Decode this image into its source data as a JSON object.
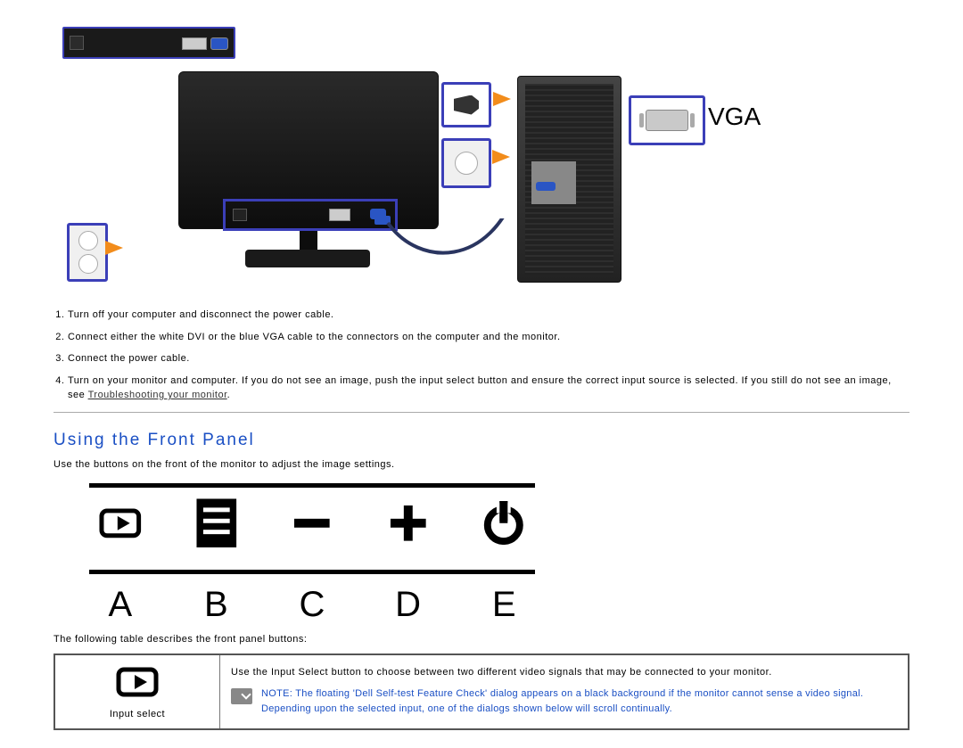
{
  "diagram": {
    "vga_label": "VGA"
  },
  "steps": {
    "s1": "Turn off your computer and disconnect the power cable.",
    "s2": "Connect either the white DVI or the blue VGA cable to the connectors on the computer and the monitor.",
    "s3": "Connect the power cable.",
    "s4a": "Turn on your monitor and computer. If you do not see an image, push the input select button and ensure the correct input source is selected. If you still do not see an image, see ",
    "s4_link": "Troubleshooting your monitor",
    "s4b": "."
  },
  "section_title": "Using the Front Panel",
  "section_intro": "Use the buttons on the front of the monitor to adjust the image settings.",
  "panel_labels": {
    "a": "A",
    "b": "B",
    "c": "C",
    "d": "D",
    "e": "E"
  },
  "table_intro": "The following table describes the front panel buttons:",
  "table": {
    "input_select_label": "Input select",
    "input_select_desc": "Use the Input Select button to choose between two different video signals that may be connected to your monitor.",
    "note": "NOTE: The floating 'Dell Self-test Feature Check' dialog appears on a black background if the monitor cannot sense a video signal. Depending upon the selected input, one of the dialogs shown below will scroll continually."
  }
}
